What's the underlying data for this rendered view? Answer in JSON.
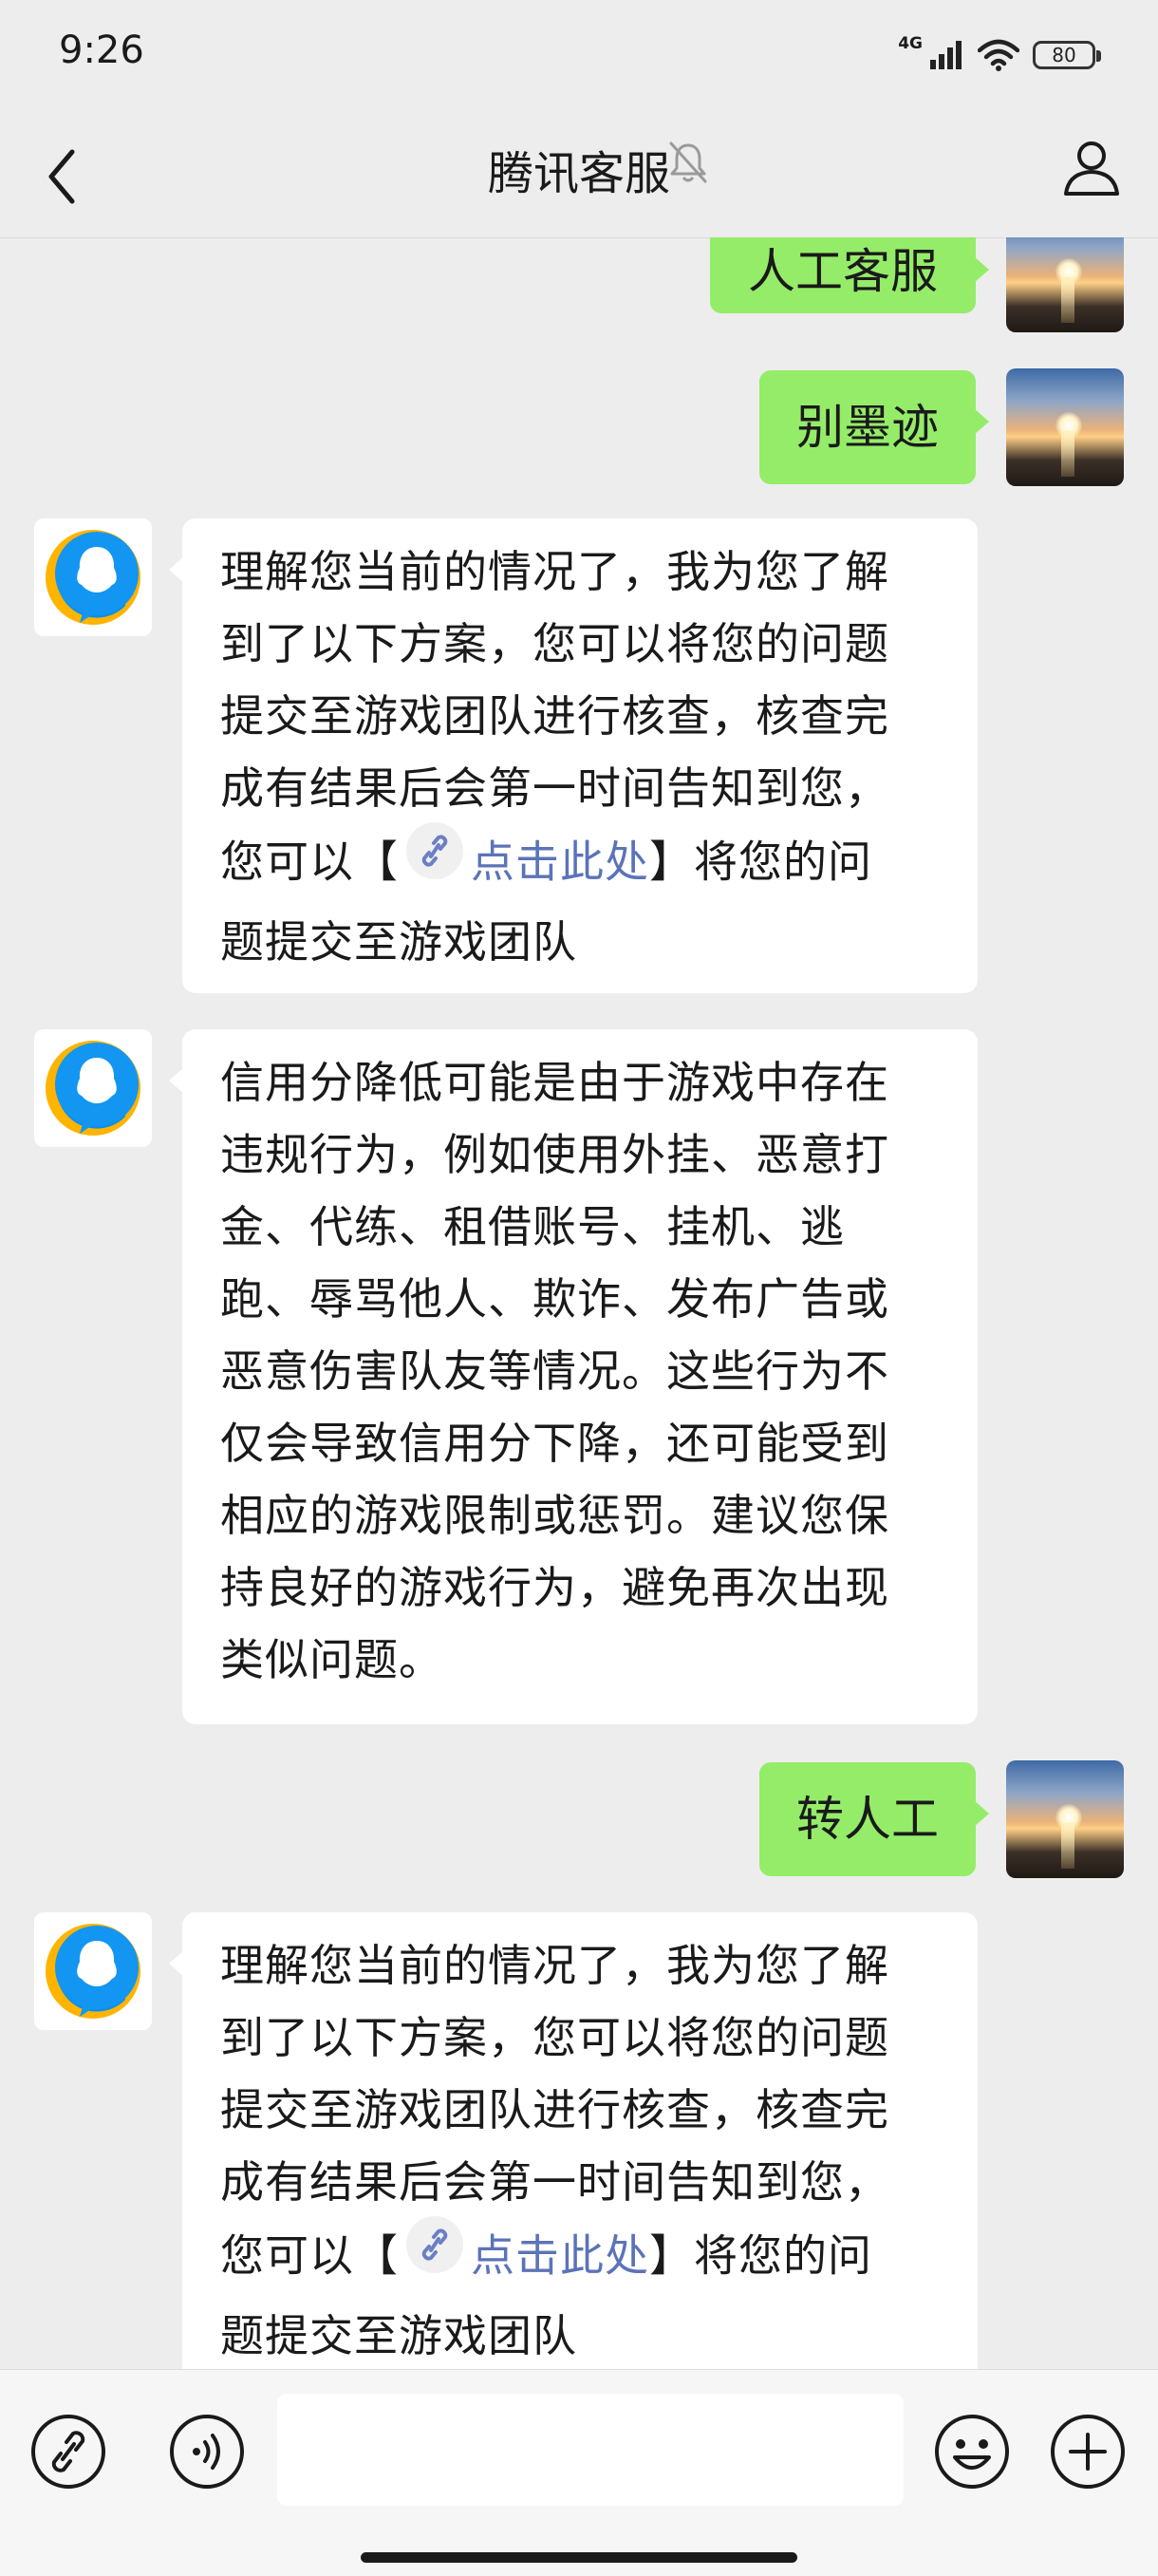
{
  "status_bar": {
    "time": "9:26",
    "network": "4G",
    "battery": "80"
  },
  "header": {
    "title": "腾讯客服"
  },
  "messages": {
    "user1": {
      "text": "人工客服"
    },
    "user2": {
      "text": "别墨迹"
    },
    "bot1": {
      "lines": [
        "理解您当前的情况了，我为您了解",
        "到了以下方案，您可以将您的问题",
        "提交至游戏团队进行核查，核查完",
        "成有结果后会第一时间告知到您，"
      ],
      "link_prefix": "您可以【",
      "link_text": "点击此处",
      "link_suffix": "】将您的问",
      "last_line": "题提交至游戏团队"
    },
    "bot2": {
      "lines": [
        "信用分降低可能是由于游戏中存在",
        "违规行为，例如使用外挂、恶意打",
        "金、代练、租借账号、挂机、逃",
        "跑、辱骂他人、欺诈、发布广告或",
        "恶意伤害队友等情况。这些行为不",
        "仅会导致信用分下降，还可能受到",
        "相应的游戏限制或惩罚。建议您保",
        "持良好的游戏行为，避免再次出现",
        "类似问题。"
      ]
    },
    "user3": {
      "text": "转人工"
    },
    "bot3": {
      "lines": [
        "理解您当前的情况了，我为您了解",
        "到了以下方案，您可以将您的问题",
        "提交至游戏团队进行核查，核查完",
        "成有结果后会第一时间告知到您，"
      ],
      "link_prefix": "您可以【",
      "link_text": "点击此处",
      "link_suffix": "】将您的问",
      "last_line": "题提交至游戏团队"
    }
  },
  "colors": {
    "user_bubble": "#95ec69",
    "bot_bubble": "#ffffff",
    "background": "#ededed",
    "link": "#5b73b8"
  },
  "icons": {
    "nav": [
      "back-arrow-icon",
      "mute-bell-icon",
      "user-profile-icon"
    ],
    "toolbar": [
      "link-icon",
      "voice-icon",
      "emoji-icon",
      "plus-icon"
    ]
  }
}
